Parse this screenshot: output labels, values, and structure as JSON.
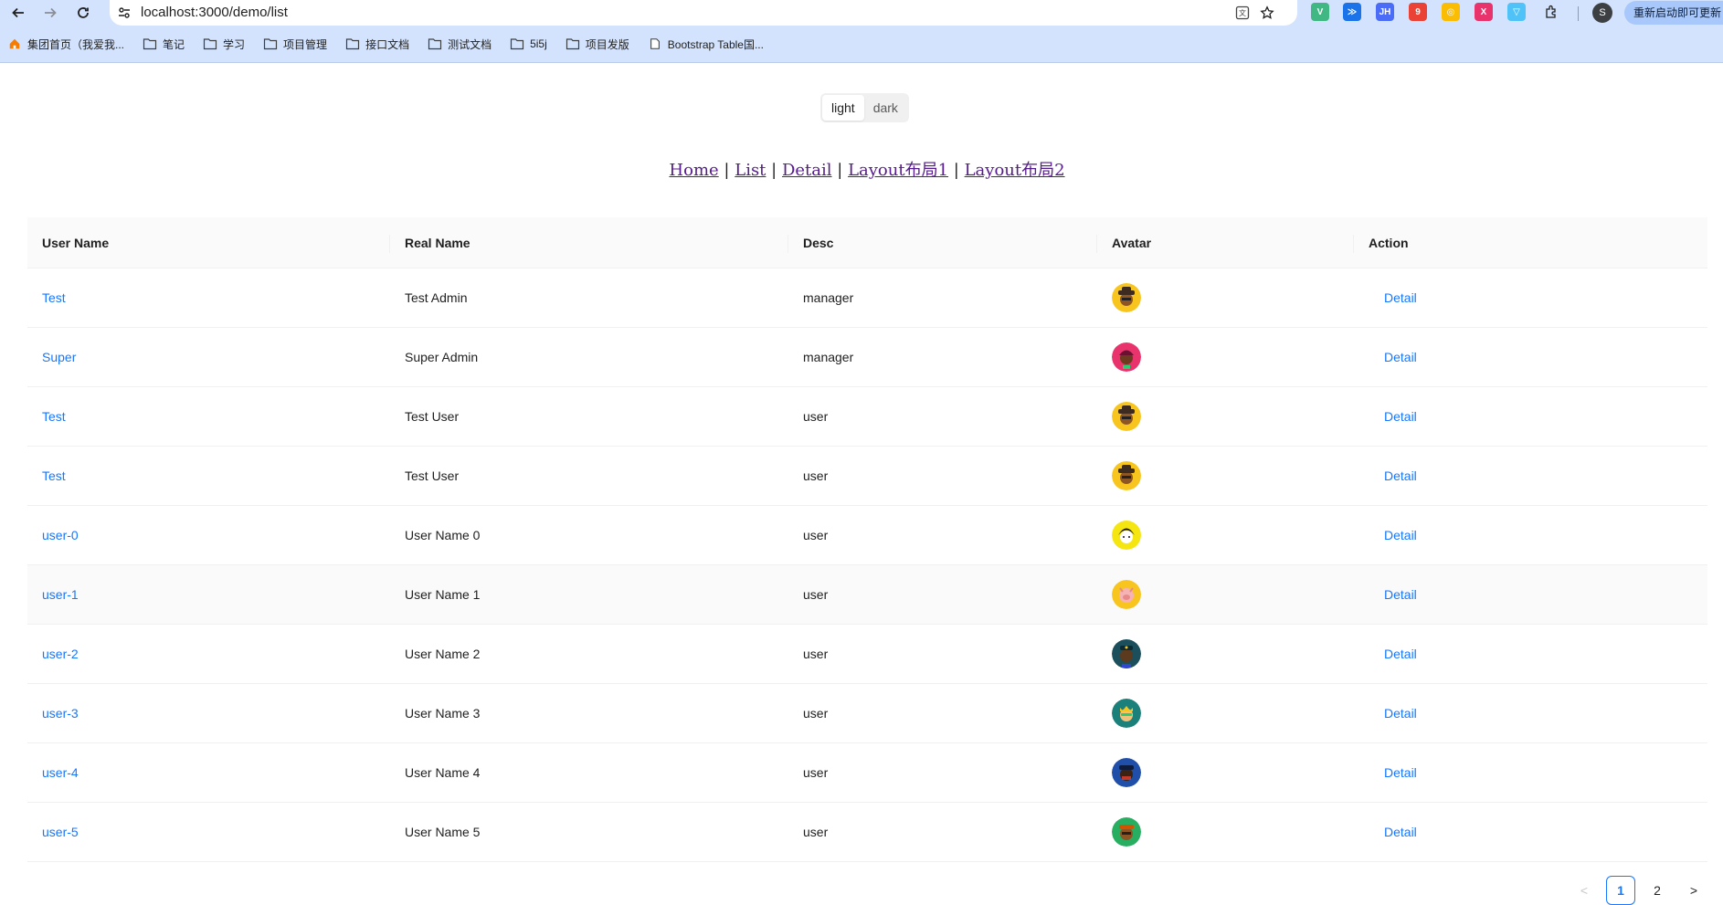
{
  "browser": {
    "url": "localhost:3000/demo/list",
    "profile_initial": "S",
    "update_label": "重新启动即可更新",
    "extensions": [
      {
        "icon": "vue-icon",
        "color": "#41b883",
        "text": "V"
      },
      {
        "icon": "download-icon",
        "color": "#1a73e8",
        "text": "≫"
      },
      {
        "icon": "jh-icon",
        "color": "#4a6cf7",
        "text": "JH"
      },
      {
        "icon": "apps-icon",
        "color": "#ea4335",
        "text": "9"
      },
      {
        "icon": "chrome-icon",
        "color": "#fbbc04",
        "text": "◎"
      },
      {
        "icon": "translate-ext-icon",
        "color": "#e8336d",
        "text": "X"
      },
      {
        "icon": "filter-icon",
        "color": "#4fc3f7",
        "text": "▽"
      }
    ]
  },
  "bookmarks": [
    {
      "label": "集团首页（我爱我...",
      "icon": "home-favicon"
    },
    {
      "label": "笔记",
      "icon": "folder-icon"
    },
    {
      "label": "学习",
      "icon": "folder-icon"
    },
    {
      "label": "项目管理",
      "icon": "folder-icon"
    },
    {
      "label": "接口文档",
      "icon": "folder-icon"
    },
    {
      "label": "测试文档",
      "icon": "folder-icon"
    },
    {
      "label": "5i5j",
      "icon": "folder-icon"
    },
    {
      "label": "项目发版",
      "icon": "folder-icon"
    },
    {
      "label": "Bootstrap Table国...",
      "icon": "page-icon"
    }
  ],
  "theme": {
    "options": [
      "light",
      "dark"
    ],
    "selected": "light"
  },
  "nav": {
    "home": "Home",
    "list": "List",
    "detail": "Detail",
    "layout1": "Layout布局1",
    "layout2": "Layout布局2",
    "sep": "|"
  },
  "table": {
    "columns": [
      "User Name",
      "Real Name",
      "Desc",
      "Avatar",
      "Action"
    ],
    "rows": [
      {
        "username": "Test",
        "realname": "Test Admin",
        "desc": "manager",
        "avatar": "hat-yellow-avatar",
        "action": "Detail"
      },
      {
        "username": "Super",
        "realname": "Super Admin",
        "desc": "manager",
        "avatar": "pink-hair-avatar",
        "action": "Detail"
      },
      {
        "username": "Test",
        "realname": "Test User",
        "desc": "user",
        "avatar": "hat-yellow-avatar",
        "action": "Detail"
      },
      {
        "username": "Test",
        "realname": "Test User",
        "desc": "user",
        "avatar": "hat-yellow-avatar",
        "action": "Detail"
      },
      {
        "username": "user-0",
        "realname": "User Name 0",
        "desc": "user",
        "avatar": "black-hair-avatar",
        "action": "Detail"
      },
      {
        "username": "user-1",
        "realname": "User Name 1",
        "desc": "user",
        "avatar": "pig-avatar",
        "action": "Detail"
      },
      {
        "username": "user-2",
        "realname": "User Name 2",
        "desc": "user",
        "avatar": "police-avatar",
        "action": "Detail"
      },
      {
        "username": "user-3",
        "realname": "User Name 3",
        "desc": "user",
        "avatar": "crown-glasses-avatar",
        "action": "Detail"
      },
      {
        "username": "user-4",
        "realname": "User Name 4",
        "desc": "user",
        "avatar": "blue-cap-avatar",
        "action": "Detail"
      },
      {
        "username": "user-5",
        "realname": "User Name 5",
        "desc": "user",
        "avatar": "green-cap-avatar",
        "action": "Detail"
      }
    ],
    "hovered_row": 5
  },
  "pagination": {
    "prev": "<",
    "pages": [
      "1",
      "2"
    ],
    "current": "1",
    "next": ">"
  },
  "colors": {
    "link": "#1677ff",
    "visited": "#551a8b",
    "chrome": "#d3e3fd"
  }
}
